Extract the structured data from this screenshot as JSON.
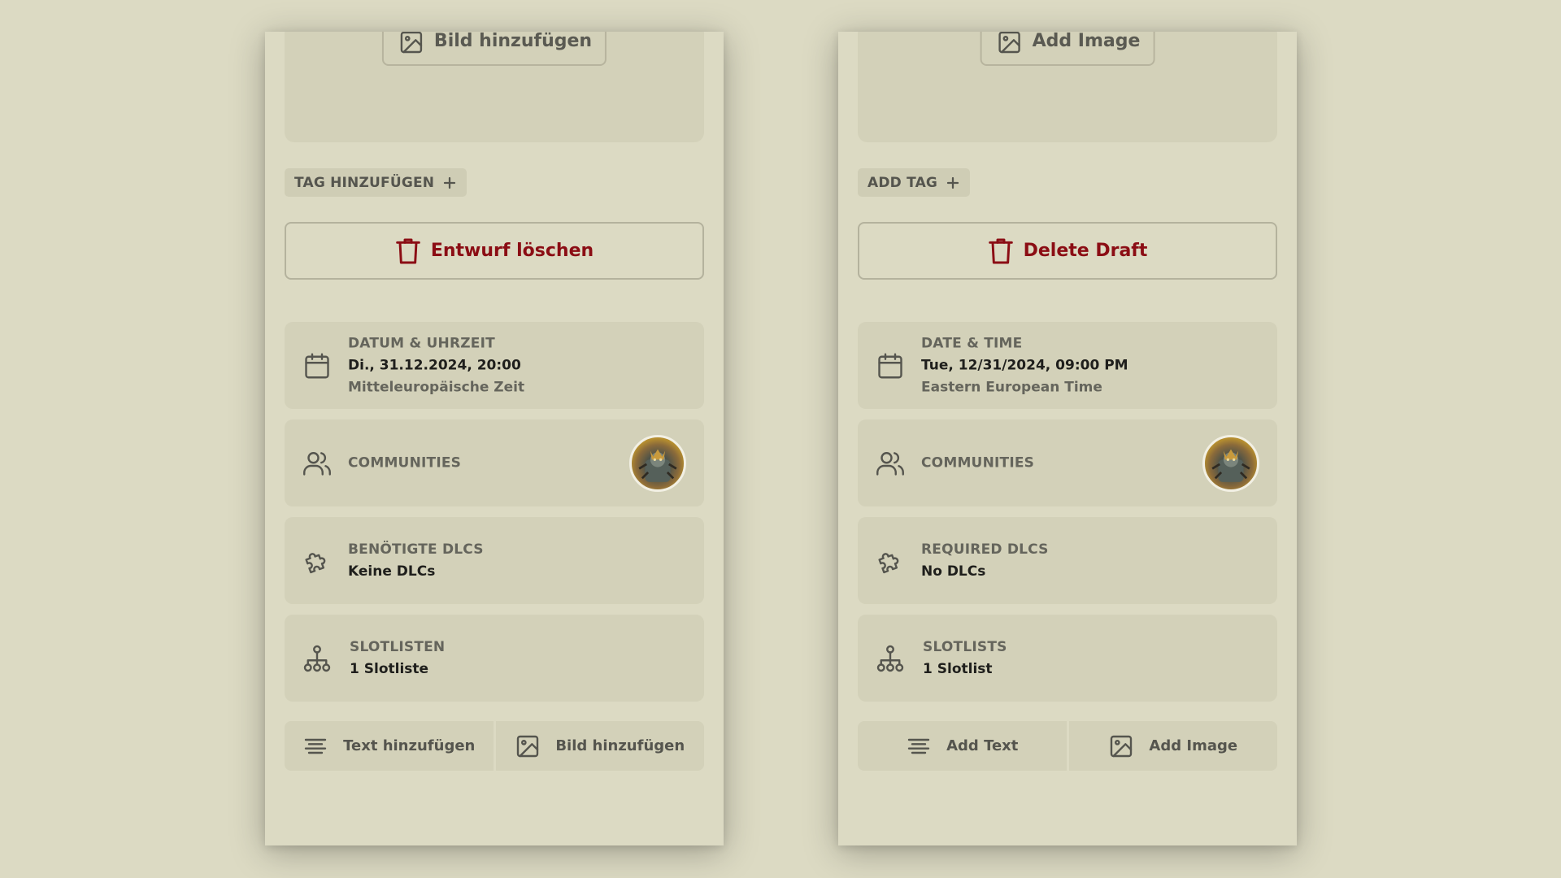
{
  "panels": {
    "de": {
      "add_image_top": "Bild hinzufügen",
      "add_tag": "TAG HINZUFÜGEN",
      "delete_draft": "Entwurf löschen",
      "datetime": {
        "title": "DATUM & UHRZEIT",
        "value": "Di., 31.12.2024, 20:00",
        "timezone": "Mitteleuropäische Zeit"
      },
      "communities": {
        "title": "COMMUNITIES"
      },
      "dlcs": {
        "title": "BENÖTIGTE DLCS",
        "value": "Keine DLCs"
      },
      "slotlists": {
        "title": "SLOTLISTEN",
        "value": "1 Slotliste"
      },
      "add_text": "Text hinzufügen",
      "add_image": "Bild hinzufügen"
    },
    "en": {
      "add_image_top": "Add Image",
      "add_tag": "ADD TAG",
      "delete_draft": "Delete Draft",
      "datetime": {
        "title": "DATE & TIME",
        "value": "Tue, 12/31/2024, 09:00 PM",
        "timezone": "Eastern European Time"
      },
      "communities": {
        "title": "COMMUNITIES"
      },
      "dlcs": {
        "title": "REQUIRED DLCS",
        "value": "No DLCs"
      },
      "slotlists": {
        "title": "SLOTLISTS",
        "value": "1 Slotlist"
      },
      "add_text": "Add Text",
      "add_image": "Add Image"
    }
  },
  "icons": {
    "image": "image-icon",
    "plus": "plus-icon",
    "trash": "trash-icon",
    "calendar": "calendar-icon",
    "users": "users-icon",
    "puzzle": "puzzle-icon",
    "hierarchy": "hierarchy-icon",
    "text_align": "text-align-icon"
  },
  "colors": {
    "background": "#dcdac3",
    "card": "#d3d1b9",
    "danger": "#8b0d14",
    "muted_text": "#65655c",
    "strong_text": "#1f1f1c"
  }
}
